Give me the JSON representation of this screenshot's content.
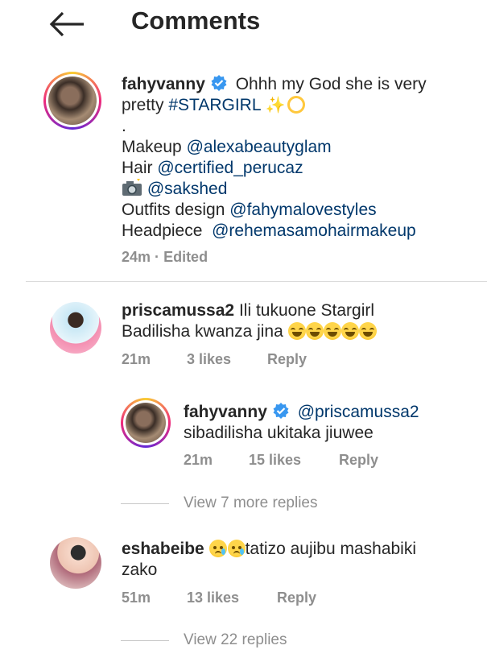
{
  "header": {
    "back_icon": "arrow-left-icon",
    "title": "Comments"
  },
  "caption": {
    "username": "fahyvanny",
    "verified": true,
    "line1_text": "Ohhh my God she is very",
    "line2_text": "pretty",
    "hashtag": "#STARGIRL",
    "line2_emojis": "sparkles, dizzy",
    "dot": ".",
    "makeup_label": "Makeup",
    "makeup_handle": "@alexabeautyglam",
    "hair_label": "Hair",
    "hair_handle": "@certified_perucaz",
    "camera_icon": "camera-flash-icon",
    "photo_handle": "@sakshed",
    "outfits_label": "Outfits design",
    "outfits_handle": "@fahymalovestyles",
    "headpiece_label": "Headpiece",
    "headpiece_handle": "@rehemasamohairmakeup",
    "time": "24m",
    "separator": "·",
    "edited": "Edited"
  },
  "comments": [
    {
      "username": "priscamussa2",
      "text1": "Ili tukuone Stargirl",
      "text2": "Badilisha kwanza jina",
      "emoji": "face-with-tears-of-joy x5",
      "time": "21m",
      "likes": "3 likes",
      "reply": "Reply",
      "reply_thread": {
        "username": "fahyvanny",
        "verified": true,
        "mention": "@priscamussa2",
        "text": "sibadilisha ukitaka jiuwee",
        "time": "21m",
        "likes": "15 likes",
        "reply": "Reply"
      },
      "view_more": "View 7 more replies"
    },
    {
      "username": "eshabeibe",
      "emoji": "crying-face x2",
      "text1": "tatizo aujibu mashabiki",
      "text2": "zako",
      "time": "51m",
      "likes": "13 likes",
      "reply": "Reply",
      "view_more": "View 22 replies"
    }
  ],
  "colors": {
    "text": "#262626",
    "link": "#00376b",
    "meta": "#8e8e8e",
    "verified": "#3897f0"
  }
}
